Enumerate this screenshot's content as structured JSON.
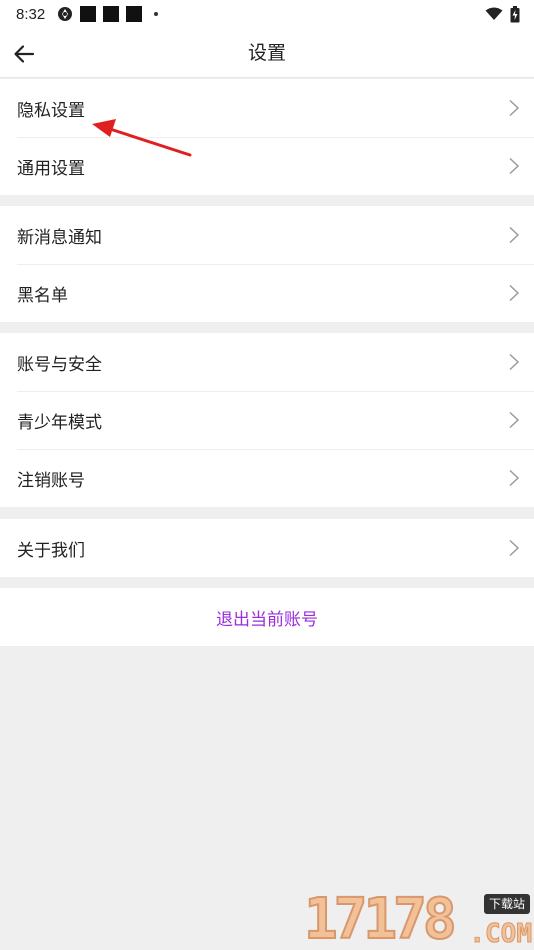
{
  "status_bar": {
    "time": "8:32",
    "icons": [
      "settings-sync-icon",
      "notification-square-icon",
      "notification-square-icon",
      "notification-square-icon",
      "more-dot-icon",
      "wifi-icon",
      "battery-charging-icon"
    ]
  },
  "header": {
    "back_icon": "arrow-left-icon",
    "title": "设置"
  },
  "groups": [
    {
      "items": [
        {
          "label": "隐私设置"
        },
        {
          "label": "通用设置"
        }
      ]
    },
    {
      "items": [
        {
          "label": "新消息通知"
        },
        {
          "label": "黑名单"
        }
      ]
    },
    {
      "items": [
        {
          "label": "账号与安全"
        },
        {
          "label": "青少年模式"
        },
        {
          "label": "注销账号"
        }
      ]
    },
    {
      "items": [
        {
          "label": "关于我们"
        }
      ]
    }
  ],
  "logout": {
    "label": "退出当前账号",
    "color": "#9a2de0"
  },
  "annotation": {
    "type": "arrow",
    "color": "#e02020",
    "points_to": "隐私设置"
  },
  "watermark": {
    "digits": "17178",
    "badge": "下载站",
    "suffix": ".COM"
  },
  "colors": {
    "background": "#efefef",
    "surface": "#ffffff",
    "text": "#222222",
    "chevron": "#9a9a9a"
  }
}
